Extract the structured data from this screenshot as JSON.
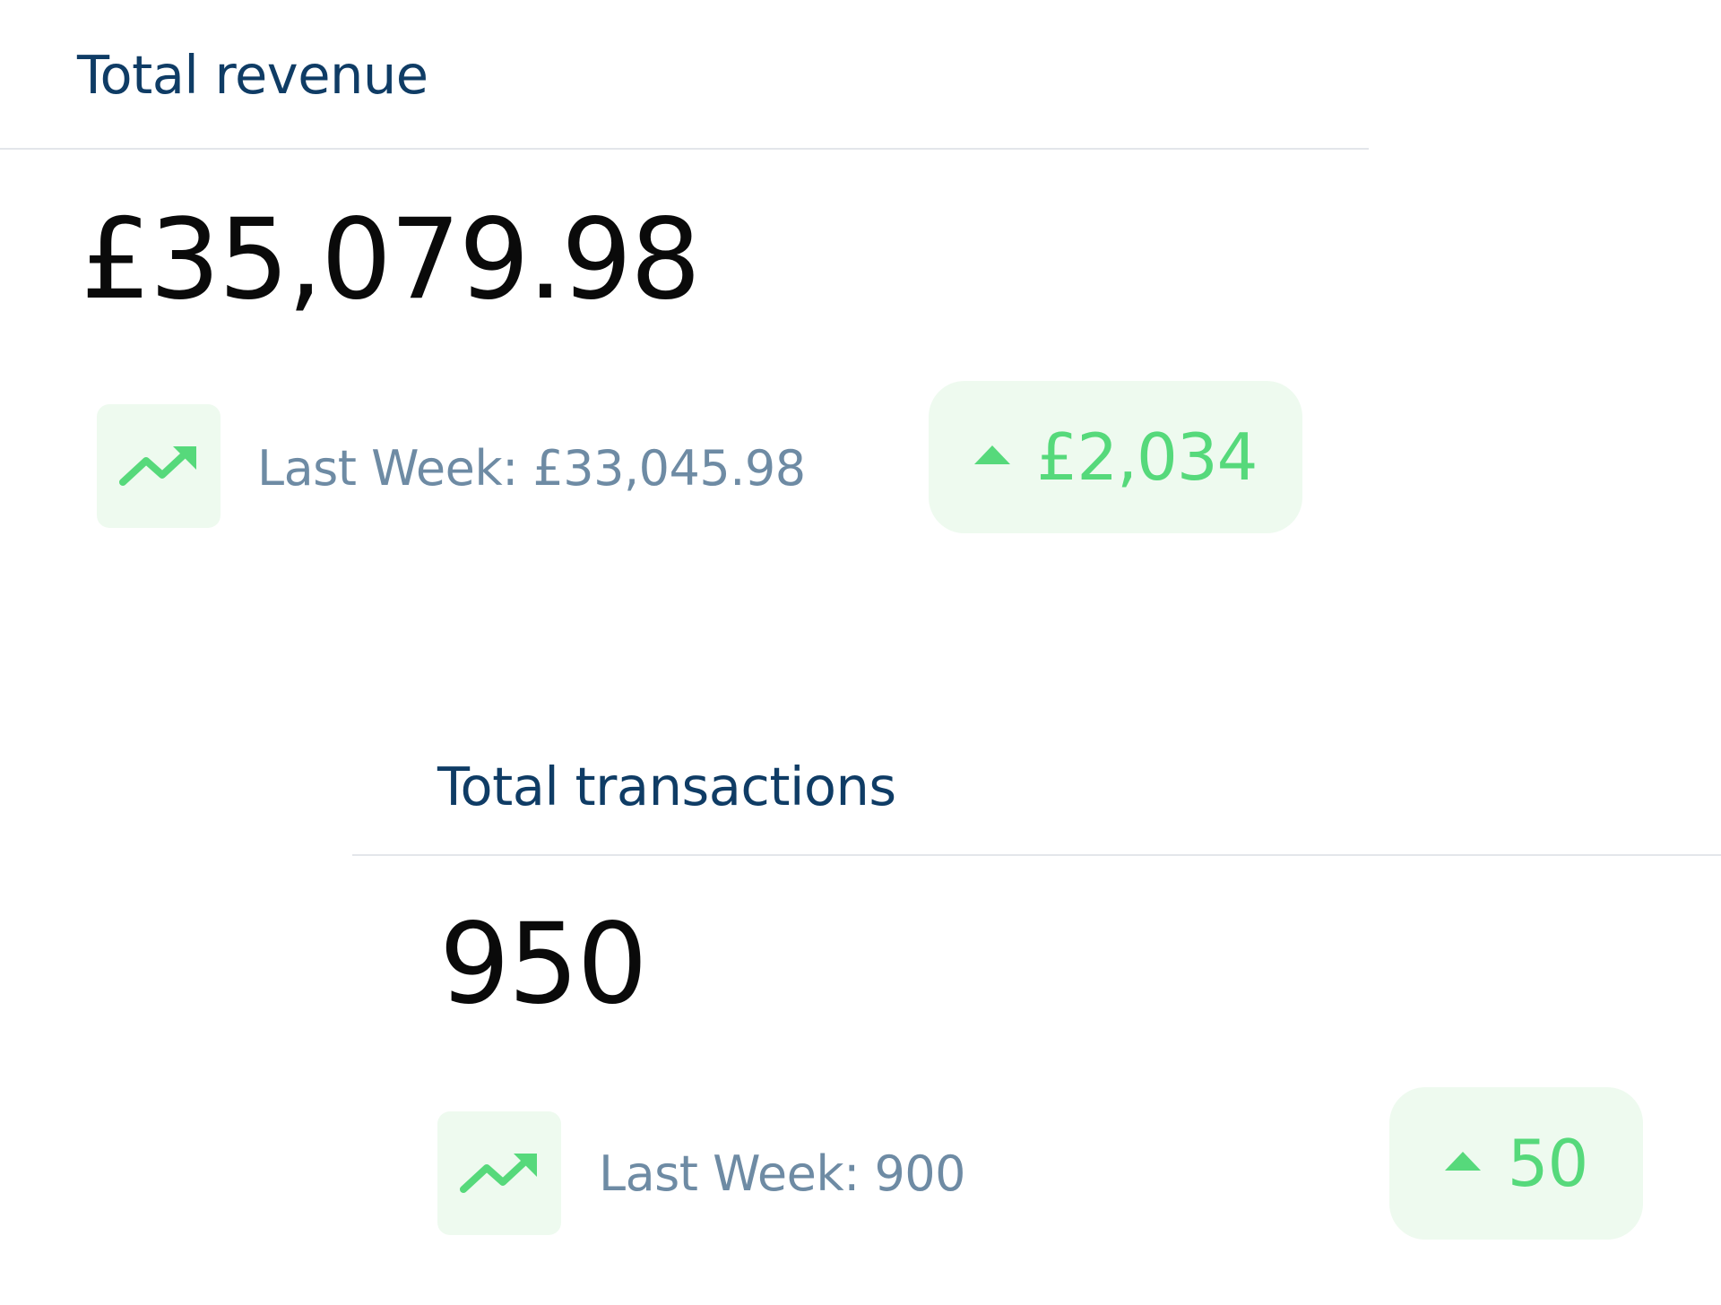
{
  "revenue": {
    "title": "Total revenue",
    "value": "£35,079.98",
    "trend_icon": "trending-up-icon",
    "last_week": "Last Week: £33,045.98",
    "delta_icon": "arrow-up-icon",
    "delta": "£2,034"
  },
  "transactions": {
    "title": "Total transactions",
    "value": "950",
    "trend_icon": "trending-up-icon",
    "last_week": "Last Week: 900",
    "delta_icon": "arrow-up-icon",
    "delta": "50"
  },
  "colors": {
    "title": "#0f3c65",
    "value": "#0a0a0a",
    "muted": "#6e8ba4",
    "positive": "#56d97b",
    "positive_bg": "#eefaef",
    "divider": "#e3e6ea"
  }
}
